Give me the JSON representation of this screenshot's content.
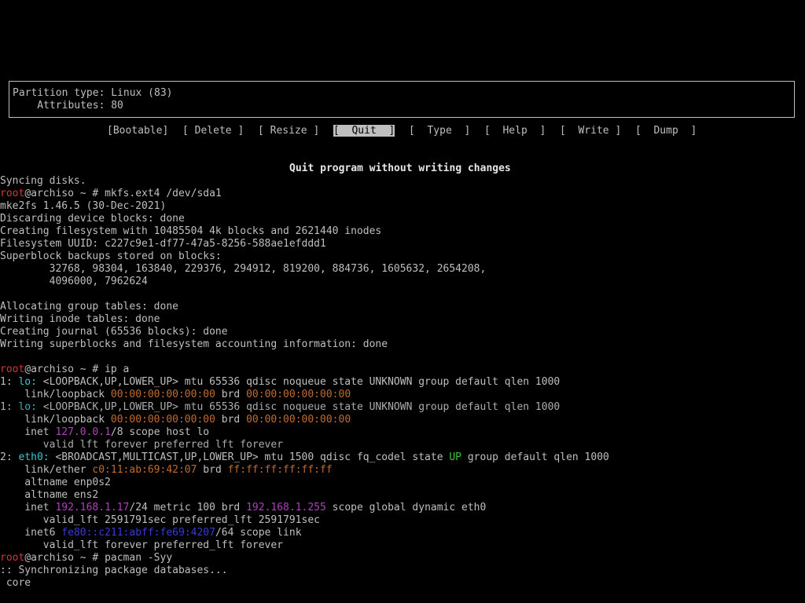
{
  "partition_info": {
    "type_line": "Partition type: Linux (83)",
    "attributes_line": "    Attributes: 80"
  },
  "menu": {
    "bootable": "[Bootable]",
    "delete": "[ Delete ]",
    "resize": "[ Resize ]",
    "quit": "[  Quit  ]",
    "type": "[  Type  ]",
    "help": "[  Help  ]",
    "write": "[  Write ]",
    "dump": "[  Dump  ]"
  },
  "help_text": "Quit program without writing changes",
  "colors": {
    "background": "#000000",
    "foreground": "#bfbfbf",
    "prompt_user": "#d23737",
    "mac_address": "#c06b2c",
    "ip_address": "#b13fbe",
    "interface": "#39c7d0",
    "state_up": "#3cc43c",
    "ipv6": "#3a3ad8"
  },
  "terminal": {
    "l01": "Syncing disks.",
    "prompt_user": "root",
    "prompt_host": "@archiso ~ # ",
    "cmd_mkfs": "mkfs.ext4 /dev/sda1",
    "l03": "mke2fs 1.46.5 (30-Dec-2021)",
    "l04": "Discarding device blocks: done",
    "l05": "Creating filesystem with 10485504 4k blocks and 2621440 inodes",
    "l06": "Filesystem UUID: c227c9e1-df77-47a5-8256-588ae1efddd1",
    "l07": "Superblock backups stored on blocks:",
    "l08": "        32768, 98304, 163840, 229376, 294912, 819200, 884736, 1605632, 2654208,",
    "l09": "        4096000, 7962624",
    "l11": "Allocating group tables: done",
    "l12": "Writing inode tables: done",
    "l13": "Creating journal (65536 blocks): done",
    "l14": "Writing superblocks and filesystem accounting information: done",
    "cmd_ip": "ip a",
    "lo_num": "1: ",
    "lo_name": "lo:",
    "lo_rest": " <LOOPBACK,UP,LOWER_UP> mtu 65536 qdisc noqueue state UNKNOWN group default qlen 1000",
    "loopback_prefix": "    link/loopback ",
    "loopback_mac": "00:00:00:00:00:00",
    "brd": " brd ",
    "loopback_brd": "00:00:00:00:00:00",
    "inet_prefix": "    inet ",
    "lo_ip": "127.0.0.1",
    "lo_ip_rest": "/8 scope host lo",
    "lo_valid": "       valid_lft forever preferred_lft forever",
    "eth_num": "2: ",
    "eth_name": "eth0:",
    "eth_rest_a": " <BROADCAST,MULTICAST,UP,LOWER_UP> mtu 1500 qdisc fq_codel state ",
    "eth_state": "UP",
    "eth_rest_b": " group default qlen 1000",
    "ether_prefix": "    link/ether ",
    "eth_mac": "c0:11:ab:69:42:07",
    "eth_brd": "ff:ff:ff:ff:ff:ff",
    "altname1": "    altname enp0s2",
    "altname2": "    altname ens2",
    "eth_ip": "192.168.1.17",
    "eth_ip_mid": "/24 metric 100 brd ",
    "eth_bcast": "192.168.1.255",
    "eth_ip_rest": " scope global dynamic eth0",
    "eth_valid": "       valid_lft 2591791sec preferred_lft 2591791sec",
    "inet6_prefix": "    inet6 ",
    "eth_ip6": "fe80::c211:abff:fe69:4207",
    "eth_ip6_rest": "/64 scope link",
    "eth_valid6": "       valid_lft forever preferred_lft forever",
    "cmd_pacman": "pacman -Syy",
    "sync_line": ":: Synchronizing package databases...",
    "core_line": " core"
  }
}
